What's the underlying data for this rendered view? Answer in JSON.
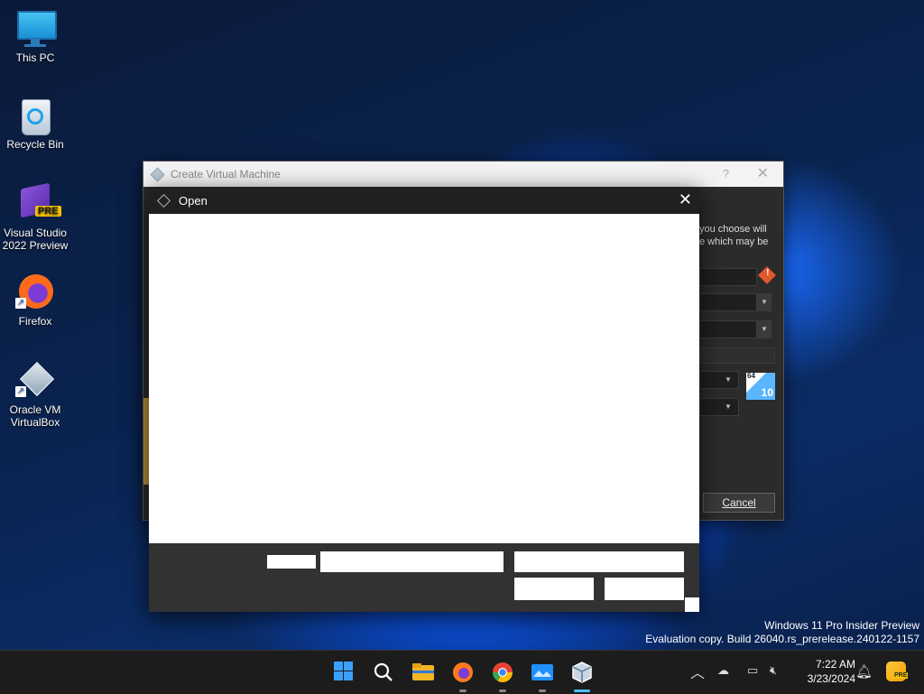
{
  "desktop": {
    "icons": [
      {
        "label_line1": "This PC",
        "label_line2": ""
      },
      {
        "label_line1": "Recycle Bin",
        "label_line2": ""
      },
      {
        "label_line1": "Visual Studio",
        "label_line2": "2022 Preview",
        "badge": "PRE"
      },
      {
        "label_line1": "Firefox",
        "label_line2": ""
      },
      {
        "label_line1": "Oracle VM",
        "label_line2": "VirtualBox"
      }
    ]
  },
  "vm_dialog": {
    "title": "Create Virtual Machine",
    "help": "?",
    "close": "✕",
    "text_line1": "you choose will",
    "text_line2": "e which may be",
    "os_badge": "10",
    "os_bits": "64",
    "cancel_label": "Cancel"
  },
  "open_dialog": {
    "title": "Open",
    "close": "✕"
  },
  "watermark": {
    "line1": "Windows 11 Pro Insider Preview",
    "line2": "Evaluation copy. Build 26040.rs_prerelease.240122-1157"
  },
  "taskbar": {
    "time": "7:22 AM",
    "date": "3/23/2024",
    "tray_badge": "PRE"
  },
  "colors": {
    "accent": "#3aa0ff",
    "dialog_dark": "#2b2b2b",
    "warning": "#e2572b"
  }
}
